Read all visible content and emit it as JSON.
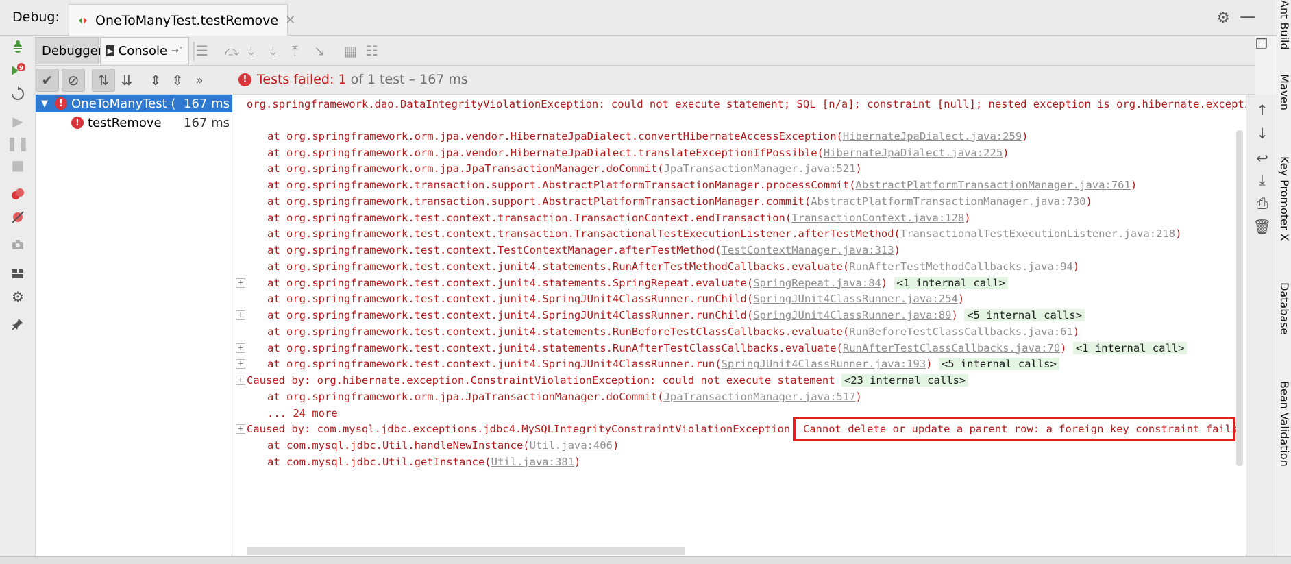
{
  "titlebar": {
    "label": "Debug:",
    "session": "OneToManyTest.testRemove"
  },
  "tabs": {
    "debugger": "Debugger",
    "console": "Console"
  },
  "status": {
    "failed_prefix": "Tests failed: ",
    "failed_count": "1",
    "failed_suffix": " of 1 test – 167 ms"
  },
  "tree": {
    "root": {
      "name": "OneToManyTest (",
      "time": "167 ms"
    },
    "child": {
      "name": "testRemove",
      "time": "167 ms"
    }
  },
  "console": {
    "lines": [
      {
        "indent": 0,
        "text": "org.springframework.dao.DataIntegrityViolationException: could not execute statement; SQL [n/a]; constraint [null]; nested exception is org.hibernate.exception.Co",
        "link": "",
        "suffix": "",
        "fold": "",
        "foldbox": false
      },
      {
        "indent": 1,
        "text": "at org.springframework.orm.jpa.vendor.HibernateJpaDialect.convertHibernateAccessException(",
        "link": "HibernateJpaDialect.java:259",
        "suffix": ")",
        "fold": "",
        "foldbox": false
      },
      {
        "indent": 1,
        "text": "at org.springframework.orm.jpa.vendor.HibernateJpaDialect.translateExceptionIfPossible(",
        "link": "HibernateJpaDialect.java:225",
        "suffix": ")",
        "fold": "",
        "foldbox": false
      },
      {
        "indent": 1,
        "text": "at org.springframework.orm.jpa.JpaTransactionManager.doCommit(",
        "link": "JpaTransactionManager.java:521",
        "suffix": ")",
        "fold": "",
        "foldbox": false
      },
      {
        "indent": 1,
        "text": "at org.springframework.transaction.support.AbstractPlatformTransactionManager.processCommit(",
        "link": "AbstractPlatformTransactionManager.java:761",
        "suffix": ")",
        "fold": "",
        "foldbox": false
      },
      {
        "indent": 1,
        "text": "at org.springframework.transaction.support.AbstractPlatformTransactionManager.commit(",
        "link": "AbstractPlatformTransactionManager.java:730",
        "suffix": ")",
        "fold": "",
        "foldbox": false
      },
      {
        "indent": 1,
        "text": "at org.springframework.test.context.transaction.TransactionContext.endTransaction(",
        "link": "TransactionContext.java:128",
        "suffix": ")",
        "fold": "",
        "foldbox": false
      },
      {
        "indent": 1,
        "text": "at org.springframework.test.context.transaction.TransactionalTestExecutionListener.afterTestMethod(",
        "link": "TransactionalTestExecutionListener.java:218",
        "suffix": ")",
        "fold": "",
        "foldbox": false
      },
      {
        "indent": 1,
        "text": "at org.springframework.test.context.TestContextManager.afterTestMethod(",
        "link": "TestContextManager.java:313",
        "suffix": ")",
        "fold": "",
        "foldbox": false
      },
      {
        "indent": 1,
        "text": "at org.springframework.test.context.junit4.statements.RunAfterTestMethodCallbacks.evaluate(",
        "link": "RunAfterTestMethodCallbacks.java:94",
        "suffix": ")",
        "fold": "",
        "foldbox": false
      },
      {
        "indent": 1,
        "text": "at org.springframework.test.context.junit4.statements.SpringRepeat.evaluate(",
        "link": "SpringRepeat.java:84",
        "suffix": ") ",
        "fold": "<1 internal call>",
        "foldbox": true
      },
      {
        "indent": 1,
        "text": "at org.springframework.test.context.junit4.SpringJUnit4ClassRunner.runChild(",
        "link": "SpringJUnit4ClassRunner.java:254",
        "suffix": ")",
        "fold": "",
        "foldbox": false
      },
      {
        "indent": 1,
        "text": "at org.springframework.test.context.junit4.SpringJUnit4ClassRunner.runChild(",
        "link": "SpringJUnit4ClassRunner.java:89",
        "suffix": ") ",
        "fold": "<5 internal calls>",
        "foldbox": true
      },
      {
        "indent": 1,
        "text": "at org.springframework.test.context.junit4.statements.RunBeforeTestClassCallbacks.evaluate(",
        "link": "RunBeforeTestClassCallbacks.java:61",
        "suffix": ")",
        "fold": "",
        "foldbox": false
      },
      {
        "indent": 1,
        "text": "at org.springframework.test.context.junit4.statements.RunAfterTestClassCallbacks.evaluate(",
        "link": "RunAfterTestClassCallbacks.java:70",
        "suffix": ") ",
        "fold": "<1 internal call>",
        "foldbox": true
      },
      {
        "indent": 1,
        "text": "at org.springframework.test.context.junit4.SpringJUnit4ClassRunner.run(",
        "link": "SpringJUnit4ClassRunner.java:193",
        "suffix": ") ",
        "fold": "<5 internal calls>",
        "foldbox": true
      },
      {
        "indent": 0,
        "text": "Caused by: org.hibernate.exception.ConstraintViolationException: could not execute statement ",
        "link": "",
        "suffix": "",
        "fold": "<23 internal calls>",
        "foldbox": true
      },
      {
        "indent": 1,
        "text": "at org.springframework.orm.jpa.JpaTransactionManager.doCommit(",
        "link": "JpaTransactionManager.java:517",
        "suffix": ")",
        "fold": "",
        "foldbox": false
      },
      {
        "indent": 1,
        "text": "... 24 more",
        "link": "",
        "suffix": "",
        "fold": "",
        "foldbox": false
      },
      {
        "indent": 0,
        "text": "Caused by: com.mysql.jdbc.exceptions.jdbc4.MySQLIntegrityConstraintViolationException: Cannot delete or update a parent row: a foreign key constraint fails (`jpa`",
        "link": "",
        "suffix": "",
        "fold": "",
        "foldbox": true
      },
      {
        "indent": 1,
        "text": "at com.mysql.jdbc.Util.handleNewInstance(",
        "link": "Util.java:406",
        "suffix": ")",
        "fold": "",
        "foldbox": false
      },
      {
        "indent": 1,
        "text": "at com.mysql.jdbc.Util.getInstance(",
        "link": "Util.java:381",
        "suffix": ")",
        "fold": "",
        "foldbox": false
      }
    ]
  },
  "sidebar_right": [
    "Ant Build",
    "Maven",
    "Key Promoter X",
    "Database",
    "Bean Validation"
  ],
  "colors": {
    "selection": "#2f79d0",
    "error": "#d9343a",
    "console_text": "#b31b1b",
    "highlight": "#e02020"
  }
}
